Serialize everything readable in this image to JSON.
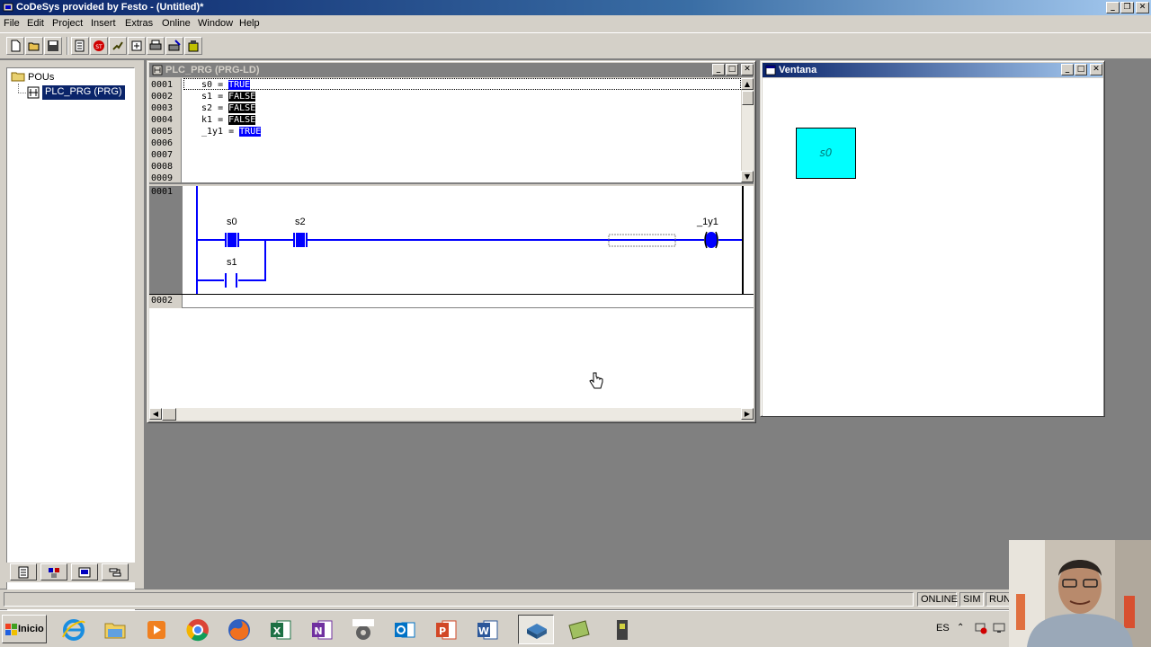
{
  "app": {
    "title": "CoDeSys provided by Festo - (Untitled)*"
  },
  "menu": [
    "File",
    "Edit",
    "Project",
    "Insert",
    "Extras",
    "Online",
    "Window",
    "Help"
  ],
  "pou_tree": {
    "root_label": "POUs",
    "items": [
      {
        "label": "PLC_PRG (PRG)",
        "selected": true
      }
    ]
  },
  "prg_window": {
    "title": "PLC_PRG (PRG-LD)",
    "line_numbers": [
      "0001",
      "0002",
      "0003",
      "0004",
      "0005",
      "0006",
      "0007",
      "0008",
      "0009"
    ],
    "declarations": [
      {
        "name": "s0",
        "sep": " = ",
        "value": "TRUE"
      },
      {
        "name": "s1",
        "sep": " = ",
        "value": "FALSE"
      },
      {
        "name": "s2",
        "sep": " = ",
        "value": "FALSE"
      },
      {
        "name": "k1",
        "sep": " = ",
        "value": "FALSE"
      },
      {
        "name": "_1y1",
        "sep": " = ",
        "value": "TRUE"
      }
    ],
    "networks": [
      {
        "number": "0001",
        "contacts": [
          {
            "label": "s0",
            "energized": true
          },
          {
            "label": "s2",
            "energized": true
          },
          {
            "label": "s1",
            "energized": false
          }
        ],
        "coil": {
          "label": "_1y1",
          "energized": true
        }
      },
      {
        "number": "0002"
      }
    ]
  },
  "ventana_window": {
    "title": "Ventana",
    "lamp_label": "s0",
    "lamp_color": "#00ffff"
  },
  "status_bar": {
    "online": "ONLINE",
    "sim": "SIM",
    "run": "RUN"
  },
  "taskbar": {
    "start_label": "Inicio",
    "language": "ES",
    "apps": [
      "internet-explorer",
      "file-explorer",
      "media-player",
      "chrome",
      "firefox",
      "excel",
      "onenote",
      "opc",
      "outlook",
      "powerpoint",
      "word",
      "codesys",
      "festo-app",
      "camera-app"
    ]
  },
  "colors": {
    "active_rung": "#0000ff",
    "true_highlight": "#0000ff",
    "false_highlight": "#000000",
    "inactive_titlebar": "#808080"
  }
}
